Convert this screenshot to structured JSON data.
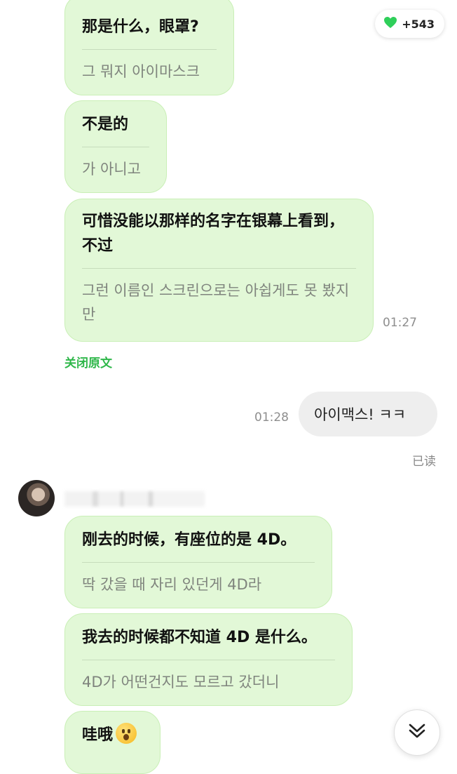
{
  "badge": {
    "icon": "heart-icon",
    "count": "+543",
    "color": "#2fcf5a"
  },
  "messages": [
    {
      "original": "那是什么，眼罩?",
      "translation": "그 뭐지 아이마스크"
    },
    {
      "original": "不是的",
      "translation": "가 아니고"
    },
    {
      "original": "可惜没能以那样的名字在银幕上看到，不过",
      "translation": "그런 이름인 스크린으로는 아쉽게도 못 봤지만",
      "time": "01:27"
    }
  ],
  "close_original_link": "关闭原文",
  "outgoing": {
    "text": "아이맥스! ㅋㅋ",
    "time": "01:28",
    "read_status": "已读"
  },
  "incoming2": [
    {
      "original": "刚去的时候，有座位的是 4D。",
      "translation": "딱 갔을 때 자리 있던게 4D라"
    },
    {
      "original": "我去的时候都不知道 4D 是什么。",
      "translation": "4D가 어떤건지도 모르고 갔더니"
    },
    {
      "original": "哇哦",
      "emoji": "hushed-face-emoji"
    }
  ],
  "scroll_button": {
    "icon": "double-chevron-down-icon"
  },
  "colors": {
    "bubble_in": "#e2f8d7",
    "bubble_out": "#eeeeee",
    "accent": "#2fb74a"
  }
}
